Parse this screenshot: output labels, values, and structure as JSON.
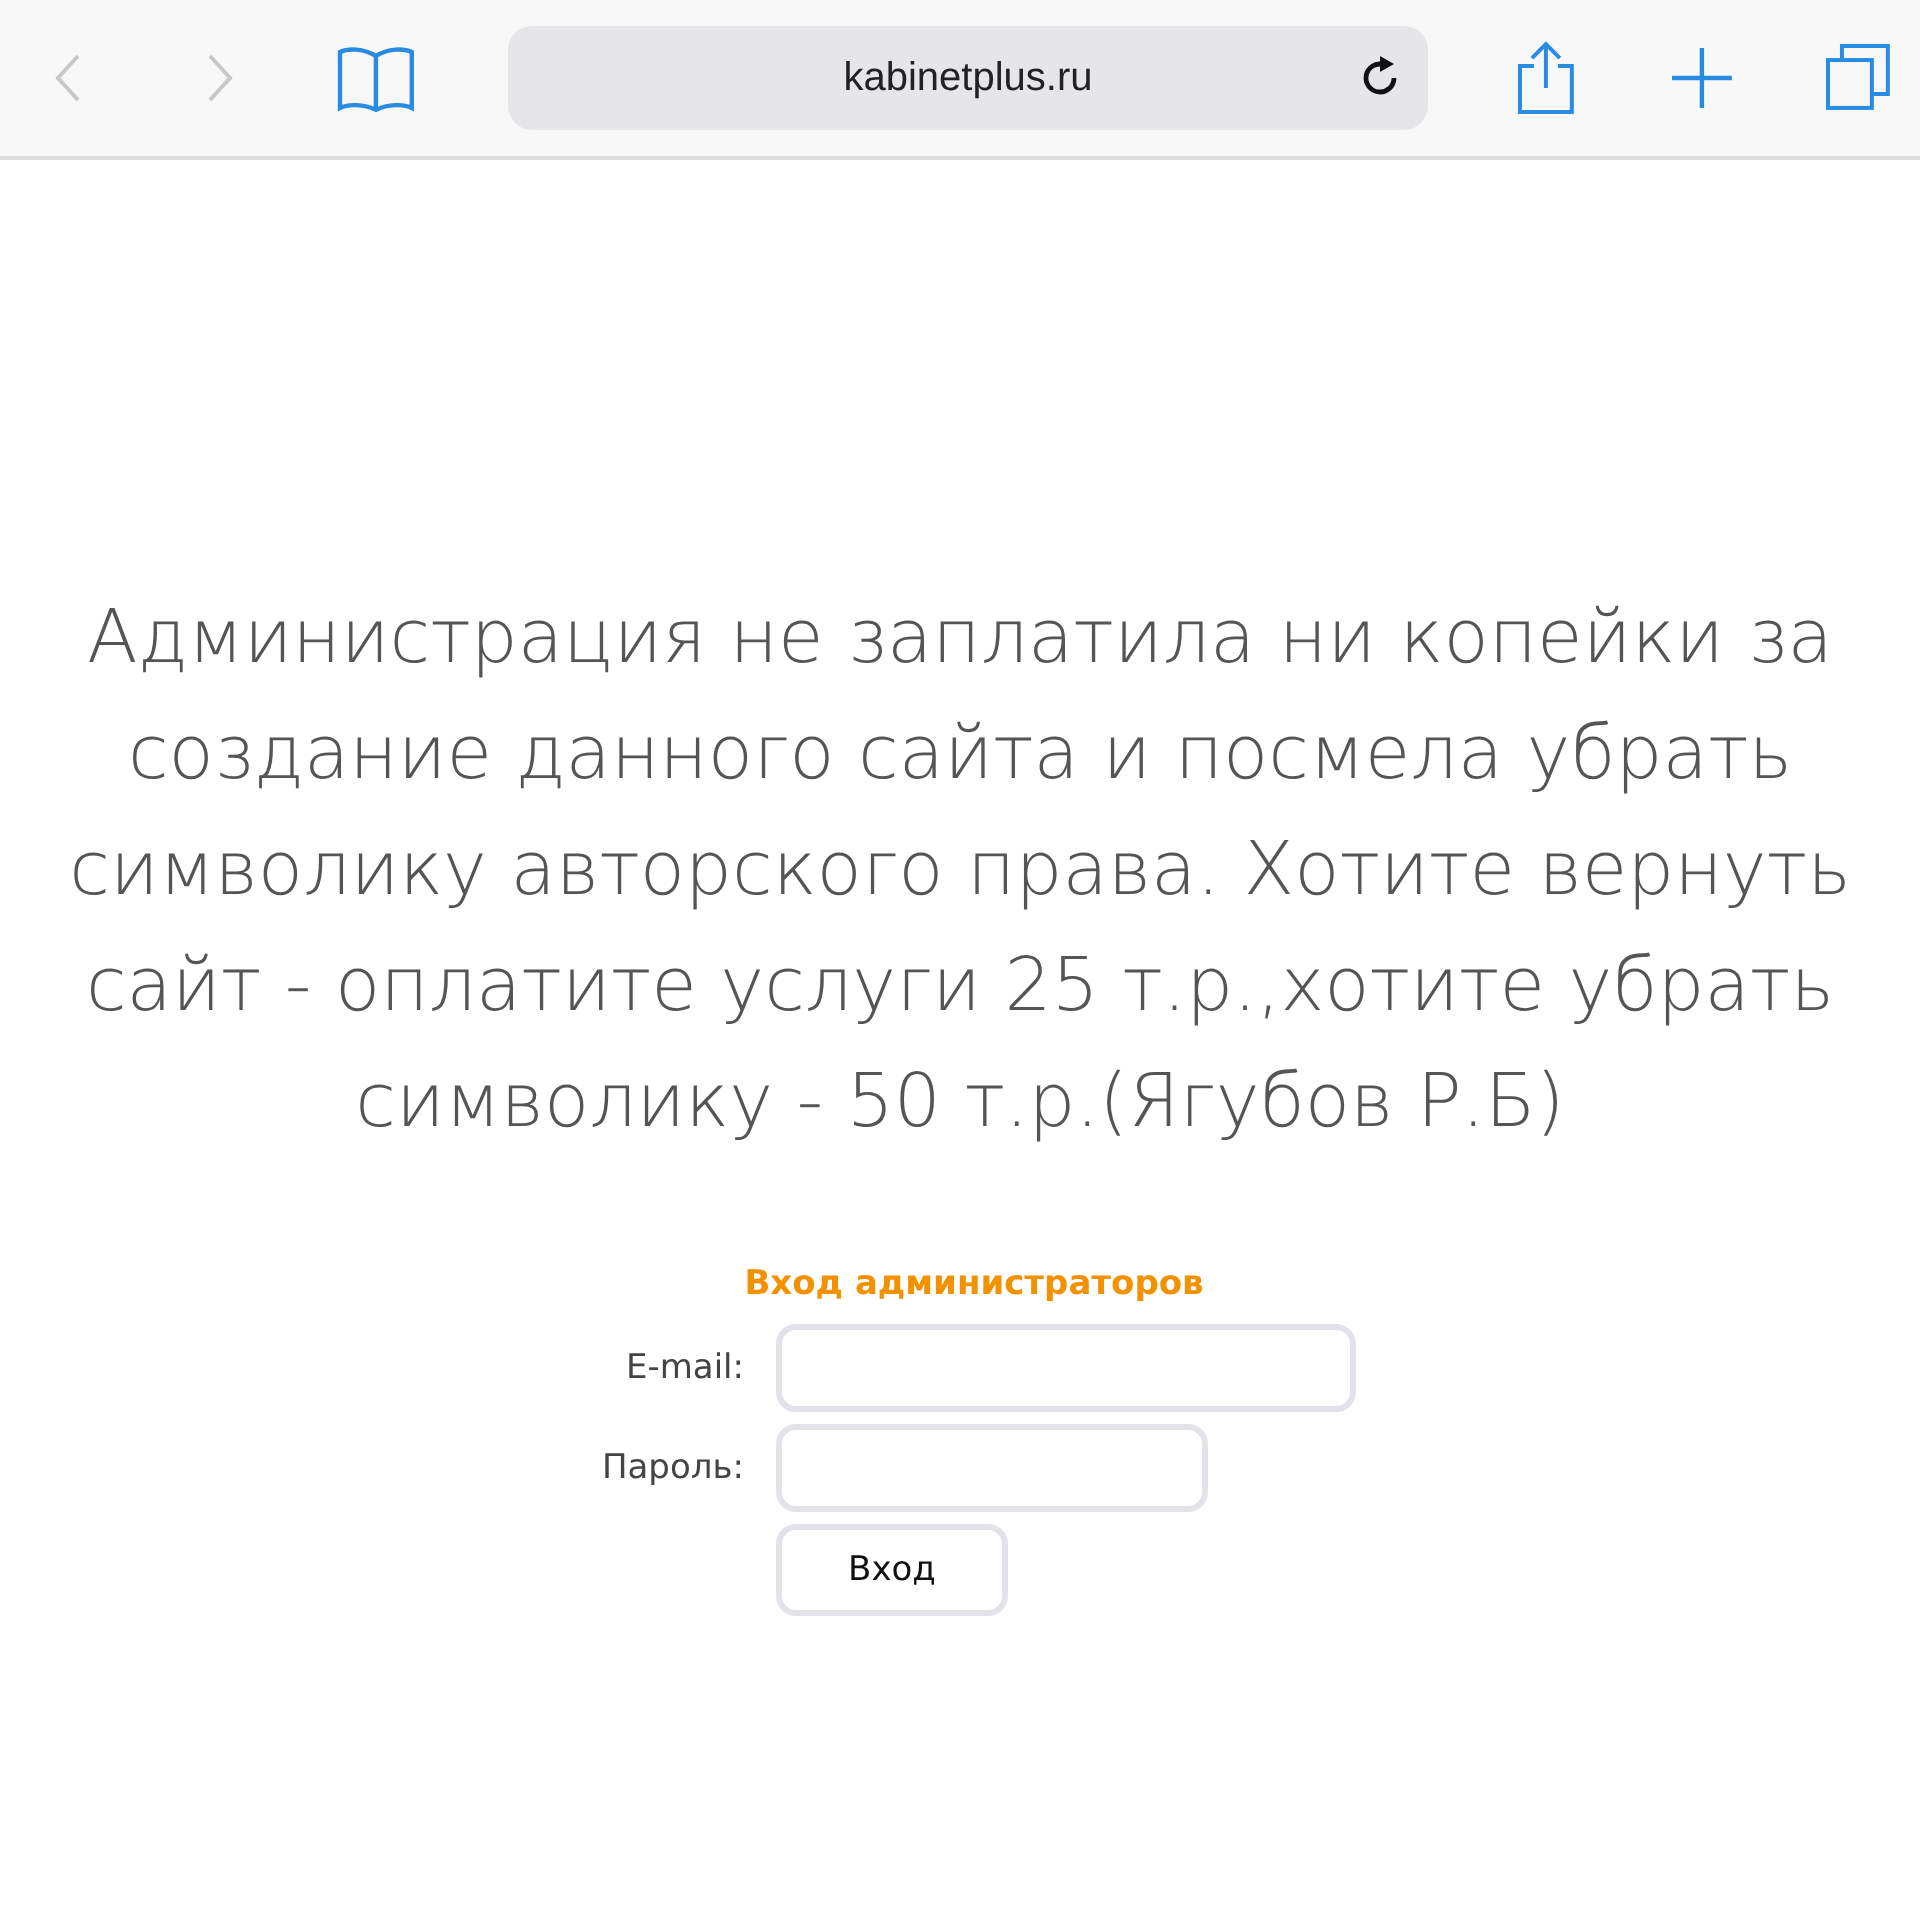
{
  "toolbar": {
    "back_disabled": true,
    "forward_disabled": true,
    "url": "kabinetplus.ru"
  },
  "message": "Администрация не заплатила ни копейки за создание данного сайта и посмела убрать символику авторского права. Хотите вернуть сайт - оплатите услуги 25 т.р.,хотите убрать символику - 50 т.р.(Ягубов Р.Б)",
  "login": {
    "title": "Вход администраторов",
    "fields": [
      {
        "label": "E-mail:",
        "kind": "email"
      },
      {
        "label": "Пароль:",
        "kind": "password"
      }
    ],
    "button": "Вход"
  }
}
